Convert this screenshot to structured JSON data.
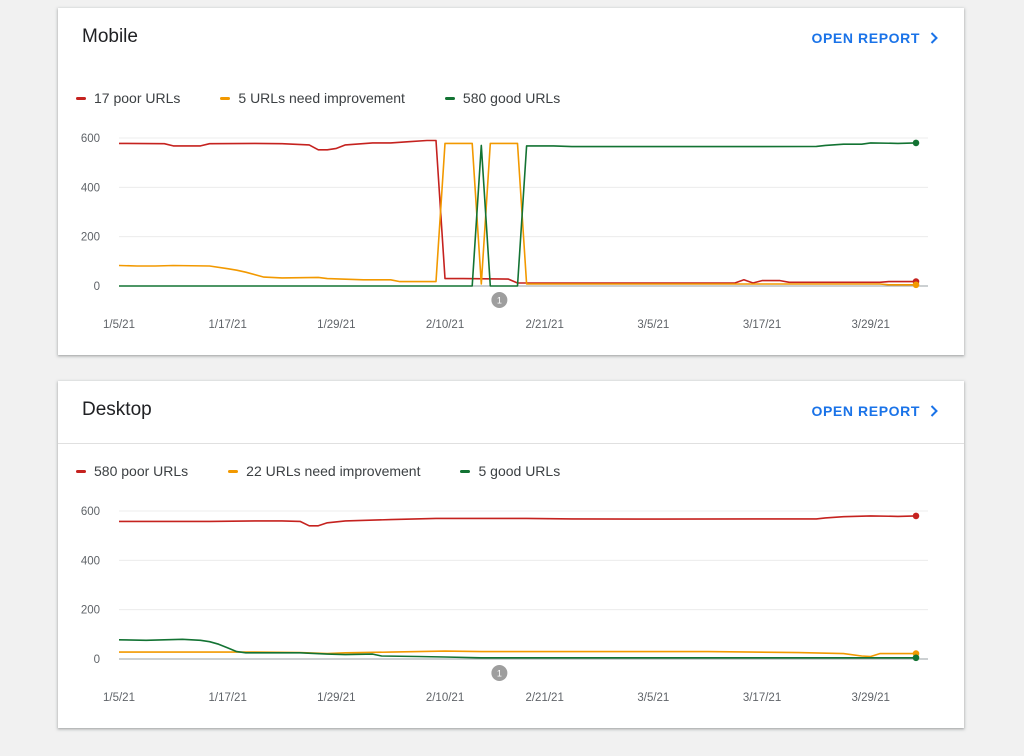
{
  "cards": [
    {
      "title": "Mobile",
      "open_report_label": "OPEN REPORT",
      "legend": [
        {
          "label": "17 poor URLs",
          "color": "#c5221f"
        },
        {
          "label": "5 URLs need improvement",
          "color": "#f29900"
        },
        {
          "label": "580 good URLs",
          "color": "#137333"
        }
      ],
      "annotation_label": "1"
    },
    {
      "title": "Desktop",
      "open_report_label": "OPEN REPORT",
      "legend": [
        {
          "label": "580 poor URLs",
          "color": "#c5221f"
        },
        {
          "label": "22 URLs need improvement",
          "color": "#f29900"
        },
        {
          "label": "5 good URLs",
          "color": "#137333"
        }
      ],
      "annotation_label": "1"
    }
  ],
  "chart_data": [
    {
      "type": "line",
      "x_start": "1/5/21",
      "x_end": "4/3/21",
      "x_tick_labels": [
        "1/5/21",
        "1/17/21",
        "1/29/21",
        "2/10/21",
        "2/21/21",
        "3/5/21",
        "3/17/21",
        "3/29/21"
      ],
      "x_tick_days": [
        0,
        12,
        24,
        36,
        47,
        59,
        71,
        83
      ],
      "ylim": [
        0,
        600
      ],
      "yticks": [
        0,
        200,
        400,
        600
      ],
      "annotation_day": 42,
      "series": [
        {
          "name": "17 poor URLs",
          "color": "#c5221f",
          "points": [
            [
              0,
              578
            ],
            [
              5,
              577
            ],
            [
              6,
              568
            ],
            [
              9,
              568
            ],
            [
              10,
              577
            ],
            [
              15,
              578
            ],
            [
              18,
              577
            ],
            [
              21,
              572
            ],
            [
              22,
              552
            ],
            [
              23,
              552
            ],
            [
              24,
              558
            ],
            [
              25,
              572
            ],
            [
              28,
              580
            ],
            [
              30,
              580
            ],
            [
              32,
              585
            ],
            [
              34,
              590
            ],
            [
              35,
              590
            ],
            [
              36,
              30
            ],
            [
              38,
              30
            ],
            [
              43,
              28
            ],
            [
              44,
              12
            ],
            [
              55,
              12
            ],
            [
              62,
              12
            ],
            [
              68,
              12
            ],
            [
              69,
              25
            ],
            [
              70,
              12
            ],
            [
              71,
              22
            ],
            [
              73,
              22
            ],
            [
              74,
              15
            ],
            [
              80,
              15
            ],
            [
              84,
              15
            ],
            [
              85,
              18
            ],
            [
              88,
              18
            ]
          ]
        },
        {
          "name": "5 URLs need improvement",
          "color": "#f29900",
          "points": [
            [
              0,
              83
            ],
            [
              2,
              81
            ],
            [
              4,
              81
            ],
            [
              6,
              83
            ],
            [
              10,
              81
            ],
            [
              12,
              70
            ],
            [
              13,
              64
            ],
            [
              14,
              56
            ],
            [
              16,
              36
            ],
            [
              18,
              33
            ],
            [
              22,
              35
            ],
            [
              23,
              30
            ],
            [
              27,
              25
            ],
            [
              30,
              25
            ],
            [
              31,
              18
            ],
            [
              34,
              18
            ],
            [
              35,
              18
            ],
            [
              36,
              578
            ],
            [
              38,
              578
            ],
            [
              39,
              578
            ],
            [
              40,
              8
            ],
            [
              41,
              578
            ],
            [
              43,
              578
            ],
            [
              44,
              578
            ],
            [
              45,
              8
            ],
            [
              60,
              8
            ],
            [
              70,
              8
            ],
            [
              73,
              8
            ],
            [
              75,
              8
            ],
            [
              80,
              8
            ],
            [
              84,
              8
            ],
            [
              85,
              5
            ],
            [
              88,
              5
            ]
          ]
        },
        {
          "name": "580 good URLs",
          "color": "#137333",
          "points": [
            [
              0,
              0
            ],
            [
              10,
              0
            ],
            [
              20,
              0
            ],
            [
              30,
              0
            ],
            [
              38,
              0
            ],
            [
              39,
              0
            ],
            [
              40,
              570
            ],
            [
              41,
              0
            ],
            [
              44,
              0
            ],
            [
              45,
              568
            ],
            [
              48,
              568
            ],
            [
              50,
              565
            ],
            [
              60,
              565
            ],
            [
              65,
              565
            ],
            [
              70,
              565
            ],
            [
              77,
              566
            ],
            [
              78,
              570
            ],
            [
              80,
              575
            ],
            [
              82,
              575
            ],
            [
              83,
              580
            ],
            [
              86,
              578
            ],
            [
              88,
              580
            ]
          ]
        }
      ]
    },
    {
      "type": "line",
      "x_start": "1/5/21",
      "x_end": "4/3/21",
      "x_tick_labels": [
        "1/5/21",
        "1/17/21",
        "1/29/21",
        "2/10/21",
        "2/21/21",
        "3/5/21",
        "3/17/21",
        "3/29/21"
      ],
      "x_tick_days": [
        0,
        12,
        24,
        36,
        47,
        59,
        71,
        83
      ],
      "ylim": [
        0,
        600
      ],
      "yticks": [
        0,
        200,
        400,
        600
      ],
      "annotation_day": 42,
      "series": [
        {
          "name": "580 poor URLs",
          "color": "#c5221f",
          "points": [
            [
              0,
              558
            ],
            [
              10,
              558
            ],
            [
              15,
              560
            ],
            [
              18,
              560
            ],
            [
              20,
              558
            ],
            [
              21,
              540
            ],
            [
              22,
              540
            ],
            [
              23,
              552
            ],
            [
              25,
              560
            ],
            [
              30,
              565
            ],
            [
              35,
              570
            ],
            [
              40,
              570
            ],
            [
              45,
              570
            ],
            [
              50,
              568
            ],
            [
              60,
              567
            ],
            [
              70,
              568
            ],
            [
              77,
              568
            ],
            [
              78,
              572
            ],
            [
              80,
              577
            ],
            [
              83,
              580
            ],
            [
              86,
              578
            ],
            [
              88,
              580
            ]
          ]
        },
        {
          "name": "22 URLs need improvement",
          "color": "#f29900",
          "points": [
            [
              0,
              28
            ],
            [
              5,
              28
            ],
            [
              10,
              28
            ],
            [
              15,
              28
            ],
            [
              20,
              26
            ],
            [
              23,
              22
            ],
            [
              25,
              25
            ],
            [
              30,
              28
            ],
            [
              33,
              30
            ],
            [
              36,
              32
            ],
            [
              40,
              30
            ],
            [
              45,
              30
            ],
            [
              50,
              30
            ],
            [
              55,
              30
            ],
            [
              60,
              30
            ],
            [
              65,
              30
            ],
            [
              70,
              28
            ],
            [
              75,
              26
            ],
            [
              80,
              22
            ],
            [
              82,
              12
            ],
            [
              83,
              10
            ],
            [
              84,
              22
            ],
            [
              88,
              22
            ]
          ]
        },
        {
          "name": "5 good URLs",
          "color": "#137333",
          "points": [
            [
              0,
              78
            ],
            [
              3,
              76
            ],
            [
              5,
              78
            ],
            [
              7,
              80
            ],
            [
              9,
              76
            ],
            [
              10,
              70
            ],
            [
              11,
              60
            ],
            [
              12,
              45
            ],
            [
              13,
              30
            ],
            [
              14,
              25
            ],
            [
              20,
              25
            ],
            [
              23,
              20
            ],
            [
              25,
              18
            ],
            [
              28,
              20
            ],
            [
              29,
              12
            ],
            [
              33,
              10
            ],
            [
              36,
              8
            ],
            [
              40,
              5
            ],
            [
              50,
              5
            ],
            [
              60,
              5
            ],
            [
              70,
              5
            ],
            [
              75,
              5
            ],
            [
              80,
              5
            ],
            [
              84,
              5
            ],
            [
              88,
              5
            ]
          ]
        }
      ]
    }
  ]
}
